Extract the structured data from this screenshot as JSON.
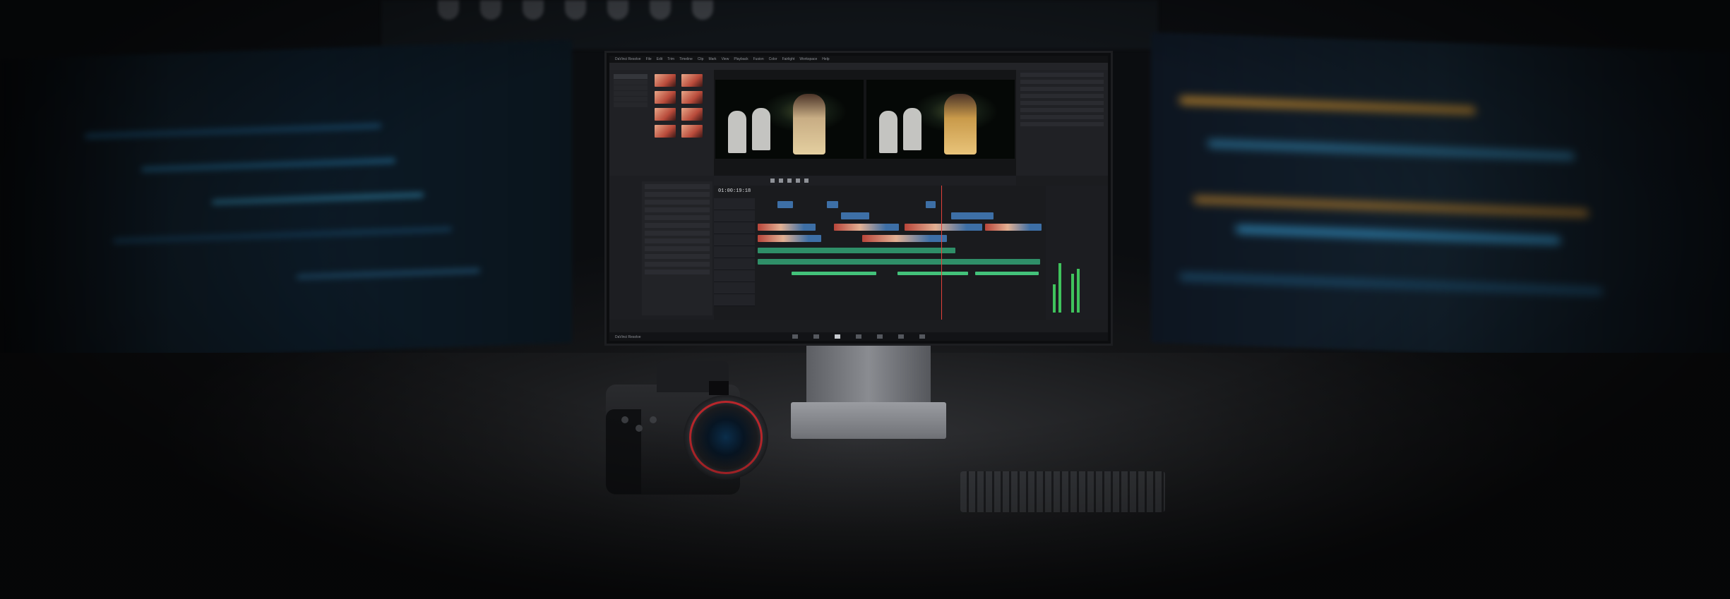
{
  "scene": {
    "colors": {
      "accent_red": "#e3413a",
      "clip_blue": "#3d6fa6",
      "audio_green": "#2f8f68",
      "lens_ring_red": "#b8262b"
    }
  },
  "resolve": {
    "menu": [
      "DaVinci Resolve",
      "File",
      "Edit",
      "Trim",
      "Timeline",
      "Clip",
      "Mark",
      "View",
      "Playback",
      "Fusion",
      "Color",
      "Fairlight",
      "Workspace",
      "Help"
    ],
    "timecode": "01:00:19:18",
    "icons": [
      "play-icon",
      "stop-icon",
      "rewind-icon",
      "fast-forward-icon",
      "loop-icon"
    ],
    "page_tabs": [
      "media-page-icon",
      "cut-page-icon",
      "edit-page-icon",
      "fusion-page-icon",
      "color-page-icon",
      "fairlight-page-icon",
      "deliver-page-icon"
    ]
  }
}
